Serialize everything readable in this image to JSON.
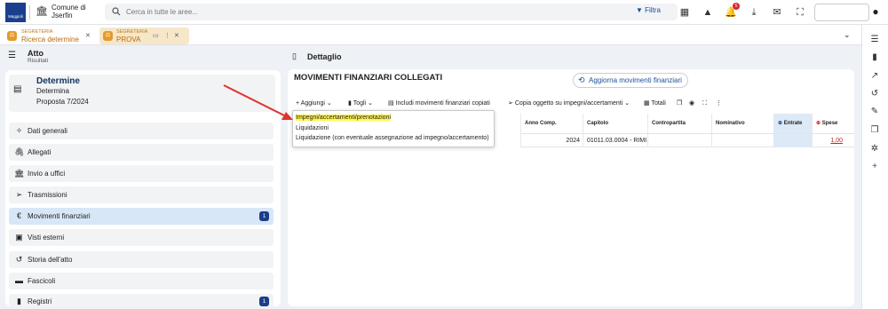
{
  "header": {
    "logo_text": "Maggioli",
    "comune_line1": "Comune di",
    "comune_line2": "Jserfin",
    "search_placeholder": "Cerca in tutte le aree...",
    "filter_label": "Filtra",
    "notification_count": "5",
    "icons": [
      "grid-icon",
      "warning-icon",
      "bell-icon",
      "download-icon",
      "mail-icon",
      "fullscreen-icon",
      "user-icon"
    ]
  },
  "tabs": [
    {
      "category": "SEGRETERIA",
      "title": "Ricerca determine"
    },
    {
      "category": "SEGRETERIA",
      "title": "PROVA"
    }
  ],
  "left": {
    "title": "Atto",
    "subtitle": "Risultati",
    "card": {
      "title": "Determine",
      "type": "Determina",
      "proposal": "Proposta 7/2024"
    },
    "items": [
      {
        "label": "Dati generali",
        "icon": "magic-wand-icon",
        "badge": ""
      },
      {
        "label": "Allegati",
        "icon": "paperclip-icon",
        "badge": ""
      },
      {
        "label": "Invio a uffici",
        "icon": "building-icon",
        "badge": ""
      },
      {
        "label": "Trasmissioni",
        "icon": "send-icon",
        "badge": ""
      },
      {
        "label": "Movimenti finanziari",
        "icon": "euro-icon",
        "badge": "1"
      },
      {
        "label": "Visti esterni",
        "icon": "stamp-icon",
        "badge": ""
      },
      {
        "label": "Storia dell'atto",
        "icon": "history-icon",
        "badge": ""
      },
      {
        "label": "Fascicoli",
        "icon": "folder-icon",
        "badge": ""
      },
      {
        "label": "Registri",
        "icon": "book-icon",
        "badge": "1"
      }
    ]
  },
  "detail": {
    "header": "Dettaglio",
    "section_title": "MOVIMENTI FINANZIARI COLLEGATI",
    "refresh_button": "Aggiorna movimenti finanziari",
    "toolbar": {
      "add": "Aggiungi",
      "remove": "Togli",
      "include_copies": "Includi movimenti finanziari copiati",
      "copy_object": "Copia oggetto su impegni/accertamenti",
      "totals": "Totali"
    },
    "dropdown": [
      "Impegni/accertamenti/prenotazioni",
      "Liquidazioni",
      "Liquidazione (con eventuale assegnazione ad impegno/accertamento)"
    ],
    "table": {
      "columns": [
        "Anno Comp.",
        "Capitolo",
        "Contropartita",
        "Nominativo",
        "Entrate",
        "Spese"
      ],
      "rows": [
        {
          "anno": "2024",
          "capitolo": "01011.03.0004 - RIMI",
          "contropartita": "",
          "nominativo": "",
          "entrate": "",
          "spese": "1,00"
        }
      ]
    }
  },
  "colors": {
    "brand": "#1b3f8f",
    "accent": "#1e4f9c",
    "tab_orange": "#e39a2e",
    "highlight": "#fff64a",
    "arrow": "#e0342f"
  }
}
